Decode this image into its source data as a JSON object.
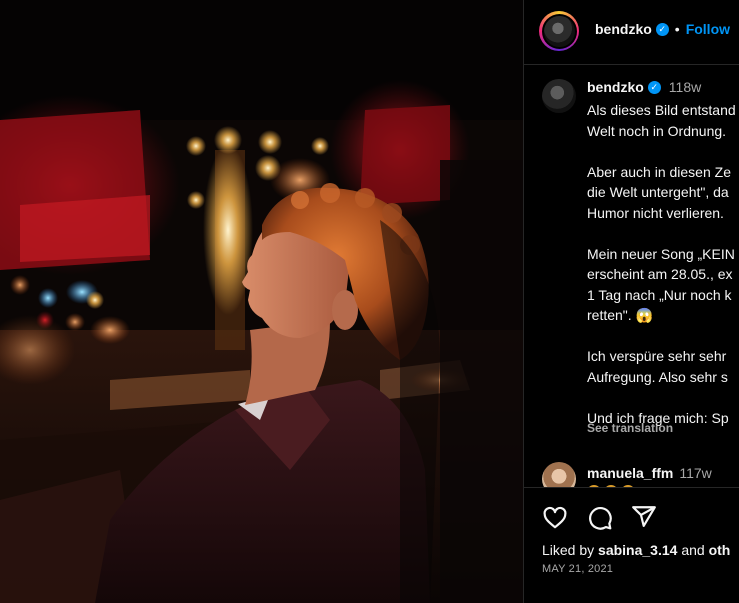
{
  "photo": {
    "alt_icon": "post-photo",
    "colors": {
      "bokeh_red": "#c0131c",
      "bokeh_warm": "#f2b24a",
      "hair": "#b5581f",
      "jacket": "#2a1113"
    }
  },
  "header": {
    "username": "bendzko",
    "separator": "•",
    "follow_label": "Follow"
  },
  "caption": {
    "username": "bendzko",
    "time": "118w",
    "lines": [
      "Als dieses Bild entstand",
      "Welt noch in Ordnung.",
      "",
      "Aber auch in diesen Ze",
      "die Welt untergeht\", da",
      "Humor nicht verlieren.",
      "",
      "Mein neuer Song „KEIN",
      "erscheint am 28.05., ex",
      "1 Tag nach „Nur noch k",
      "retten\". 😱",
      "",
      "Ich verspüre sehr sehr",
      "Aufregung. Also sehr s",
      "",
      "Und ich frage mich: Sp"
    ],
    "see_translation": "See translation"
  },
  "comment": {
    "username": "manuela_ffm",
    "time": "117w"
  },
  "actions": {
    "like_icon": "heart-icon",
    "comment_icon": "comment-icon",
    "share_icon": "send-icon"
  },
  "likes": {
    "prefix": "Liked by",
    "user": "sabina_3.14",
    "suffix": "and",
    "others": "oth"
  },
  "date": "MAY 21, 2021",
  "colors": {
    "accent": "#0095f6",
    "muted": "#a8a8a8",
    "border": "#262626"
  }
}
